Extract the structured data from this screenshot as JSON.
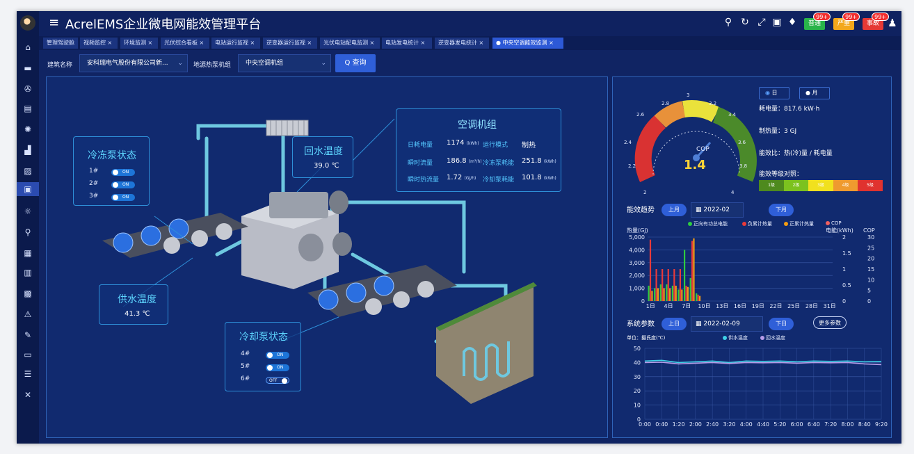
{
  "app": {
    "title": "AcrelEMS企业微电网能效管理平台"
  },
  "header_badges": [
    {
      "label": "普通",
      "count": "99+",
      "color": "#29b34a"
    },
    {
      "label": "严重",
      "count": "99+",
      "color": "#f3a81b"
    },
    {
      "label": "事故",
      "count": "99+",
      "color": "#e53935"
    }
  ],
  "tabs": [
    "管理驾驶舱",
    "视频监控 ×",
    "环境监测 ×",
    "光伏综合看板 ×",
    "电站运行监视 ×",
    "逆变器运行监视 ×",
    "光伏电站配电监测 ×",
    "电站发电统计 ×",
    "逆变器发电统计 ×",
    "● 中央空调能效监测 ×"
  ],
  "filters": {
    "building_label": "建筑名称",
    "building_value": "安科瑞电气股份有限公司新...",
    "unit_label": "地源热泵机组",
    "unit_value": "中央空调机组",
    "query_label": "Q 查询"
  },
  "chiller_pump": {
    "title": "冷冻泵状态",
    "pumps": [
      {
        "id": "1#",
        "state": "ON"
      },
      {
        "id": "2#",
        "state": "ON"
      },
      {
        "id": "3#",
        "state": "ON"
      }
    ]
  },
  "cooling_pump": {
    "title": "冷却泵状态",
    "pumps": [
      {
        "id": "4#",
        "state": "ON"
      },
      {
        "id": "5#",
        "state": "ON"
      },
      {
        "id": "6#",
        "state": "OFF"
      }
    ]
  },
  "return_water": {
    "title": "回水温度",
    "value": "39.0 ℃"
  },
  "supply_water": {
    "title": "供水温度",
    "value": "41.3 ℃"
  },
  "ac_unit": {
    "title": "空调机组",
    "rows": [
      {
        "label": "日耗电量",
        "value": "1174",
        "unit": "(kWh)"
      },
      {
        "label": "运行模式",
        "value": "制热",
        "unit": ""
      },
      {
        "label": "瞬时流量",
        "value": "186.8",
        "unit": "(m³/h)"
      },
      {
        "label": "冷冻泵耗能",
        "value": "251.8",
        "unit": "(kWh)"
      },
      {
        "label": "瞬时热流量",
        "value": "1.72",
        "unit": "(GJ/h)"
      },
      {
        "label": "冷却泵耗能",
        "value": "101.8",
        "unit": "(kWh)"
      }
    ]
  },
  "gauge": {
    "label": "COP",
    "value": 1.4,
    "value_text": "1.4",
    "min": 2,
    "max": 4,
    "ticks": [
      "2",
      "2.2",
      "2.4",
      "2.6",
      "2.8",
      "3",
      "3.2",
      "3.4",
      "3.6",
      "3.8",
      "4"
    ]
  },
  "period": {
    "day": "日",
    "month": "月"
  },
  "summary": {
    "power": "耗电量：817.6 kW·h",
    "heat": "制热量：3 GJ",
    "ratio": "能效比：热(冷)量 / 耗电量",
    "level_title": "能效等级对照：",
    "levels": [
      {
        "label": "1级",
        "color": "#4e8a1e"
      },
      {
        "label": "2级",
        "color": "#7cc21f"
      },
      {
        "label": "3级",
        "color": "#f1e11e"
      },
      {
        "label": "4级",
        "color": "#ef9a2f"
      },
      {
        "label": "5级",
        "color": "#e0322f"
      }
    ]
  },
  "trend": {
    "title": "能效趋势",
    "prev": "上月",
    "date": "2022-02",
    "next": "下月",
    "legend": [
      {
        "label": "正向有功总电能",
        "color": "#2ecc40"
      },
      {
        "label": "负累计热量",
        "color": "#e83a3a"
      },
      {
        "label": "正累计热量",
        "color": "#f39c12"
      },
      {
        "label": "COP",
        "color": "#f06060"
      }
    ],
    "y_left_title": "热量(GJ)",
    "y_right_title1": "电能(kWh)",
    "y_right_title2": "COP",
    "y_left_ticks": [
      "0",
      "1,000",
      "2,000",
      "3,000",
      "4,000",
      "5,000"
    ],
    "y_right1_ticks": [
      "0",
      "0.5",
      "1",
      "1.5",
      "2"
    ],
    "y_right2_ticks": [
      "0",
      "5",
      "10",
      "15",
      "20",
      "25",
      "30"
    ],
    "x_ticks": [
      "1日",
      "4日",
      "7日",
      "10日",
      "13日",
      "16日",
      "19日",
      "22日",
      "25日",
      "28日",
      "31日"
    ]
  },
  "sys": {
    "title": "系统参数",
    "prev": "上日",
    "date": "2022-02-09",
    "next": "下日",
    "more": "更多参数",
    "unit": "单位：摄氏度(℃)",
    "legend": [
      {
        "label": "供水温度",
        "color": "#3fd0e6"
      },
      {
        "label": "回水温度",
        "color": "#b69ce8"
      }
    ]
  },
  "chart_data": [
    {
      "type": "bar",
      "title": "能效趋势",
      "ylabel": "热量(GJ)",
      "categories": [
        "1日",
        "2日",
        "3日",
        "4日",
        "5日",
        "6日",
        "7日",
        "8日",
        "9日"
      ],
      "ylim": [
        0,
        5000
      ],
      "series": [
        {
          "name": "正向有功总电能",
          "values": [
            1200,
            1000,
            1300,
            1300,
            1200,
            900,
            4000,
            1800,
            600
          ]
        },
        {
          "name": "负累计热量",
          "values": [
            4800,
            2500,
            2500,
            2500,
            2500,
            2500,
            1200,
            4700,
            500
          ]
        },
        {
          "name": "正累计热量",
          "values": [
            800,
            1000,
            1000,
            1000,
            1200,
            900,
            1100,
            4900,
            400
          ]
        }
      ]
    },
    {
      "type": "line",
      "title": "系统参数",
      "ylabel": "单位：摄氏度(℃)",
      "x": [
        "0:00",
        "0:40",
        "1:20",
        "2:00",
        "2:40",
        "3:20",
        "4:00",
        "4:40",
        "5:20",
        "6:00",
        "6:40",
        "7:20",
        "8:00",
        "8:40",
        "9:20"
      ],
      "ylim": [
        0,
        50
      ],
      "series": [
        {
          "name": "供水温度",
          "values": [
            41,
            41.5,
            40,
            40.5,
            41,
            40,
            41,
            40.8,
            41,
            40.5,
            41,
            40.8,
            41,
            40.5,
            40.8
          ]
        },
        {
          "name": "回水温度",
          "values": [
            40,
            40.2,
            39,
            39.5,
            40,
            39.3,
            40,
            39.8,
            40,
            39.5,
            40,
            39.8,
            40,
            39,
            38.5
          ]
        }
      ]
    }
  ]
}
